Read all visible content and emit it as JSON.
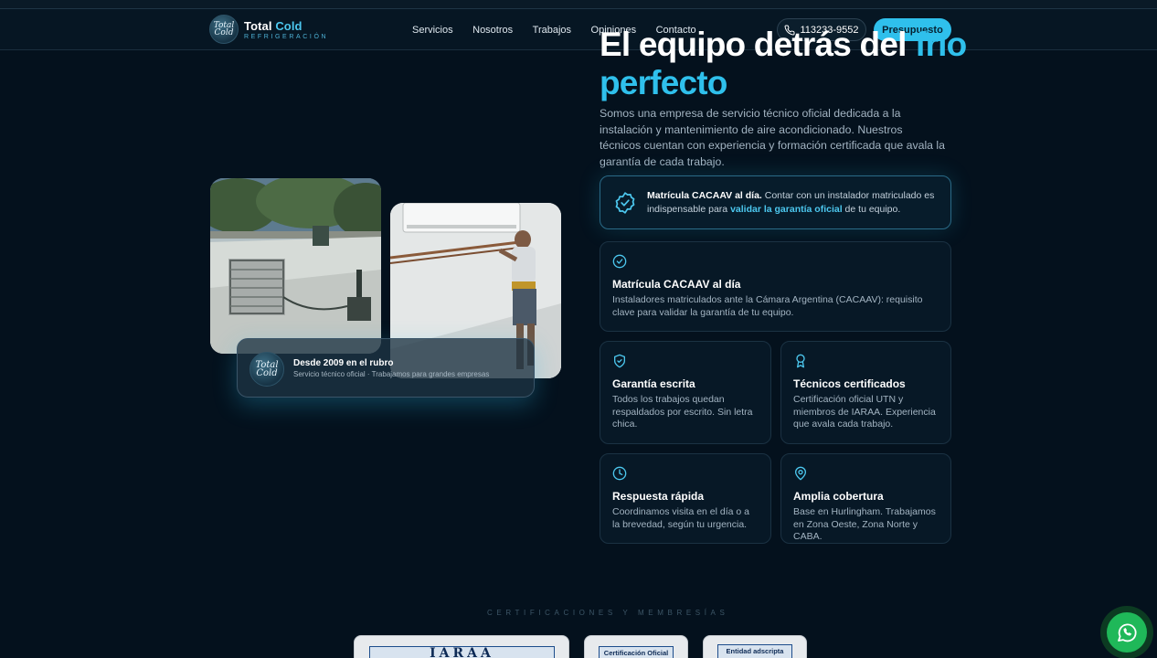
{
  "brand": {
    "badge_text": "Total Cold",
    "name_part1": "Total",
    "name_part2": "Cold",
    "tagline": "REFRIGERACIÓN"
  },
  "nav": {
    "items": [
      "Servicios",
      "Nosotros",
      "Trabajos",
      "Opiniones",
      "Contacto"
    ]
  },
  "header_actions": {
    "phone": "113233-9552",
    "cta": "Presupuesto"
  },
  "hero": {
    "heading_line1_white": "El equipo detrás del ",
    "heading_line1_accent": "frío",
    "heading_line2_accent": "perfecto",
    "intro": "Somos una empresa de servicio técnico oficial dedicada a la instalación y mantenimiento de aire acondicionado. Nuestros técnicos cuentan con experiencia y formación certificada que avala la garantía de cada trabajo."
  },
  "photo_caption": {
    "badge_text": "Total Cold",
    "title": "Desde 2009 en el rubro",
    "subtitle": "Servicio técnico oficial · Trabajamos para grandes empresas"
  },
  "highlight": {
    "bold": "Matrícula CACAAV al día.",
    "text_before_link": " Contar con un instalador matriculado es indispensable para ",
    "link": "validar la garantía oficial",
    "text_after_link": " de tu equipo."
  },
  "cards": [
    {
      "icon": "check-circle-icon",
      "title": "Matrícula CACAAV al día",
      "desc": "Instaladores matriculados ante la Cámara Argentina (CACAAV): requisito clave para validar la garantía de tu equipo."
    },
    {
      "icon": "shield-check-icon",
      "title": "Garantía escrita",
      "desc": "Todos los trabajos quedan respaldados por escrito. Sin letra chica."
    },
    {
      "icon": "award-icon",
      "title": "Técnicos certificados",
      "desc": "Certificación oficial UTN y miembros de IARAA. Experiencia que avala cada trabajo."
    },
    {
      "icon": "clock-icon",
      "title": "Respuesta rápida",
      "desc": "Coordinamos visita en el día o a la brevedad, según tu urgencia."
    },
    {
      "icon": "map-pin-icon",
      "title": "Amplia cobertura",
      "desc": "Base en Hurlingham. Trabajamos en Zona Oeste, Zona Norte y CABA."
    }
  ],
  "certifications": {
    "label": "CERTIFICACIONES Y MEMBRESÍAS",
    "items": [
      "IARAA",
      "Certificación Oficial",
      "Entidad adscripta"
    ]
  },
  "colors": {
    "background": "#04111d",
    "accent": "#2fc0ec",
    "whatsapp": "#1fb859"
  }
}
